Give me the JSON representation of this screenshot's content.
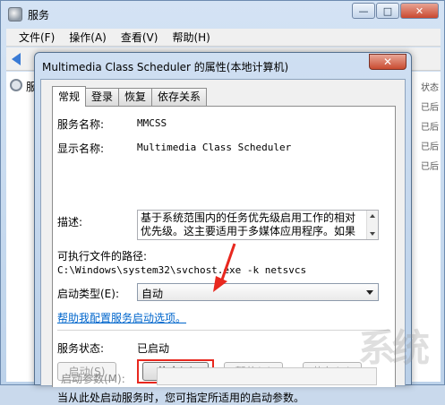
{
  "background_window": {
    "title": "服务",
    "window_buttons": {
      "minimize": "—",
      "maximize": "□",
      "close": "✕"
    },
    "menu": [
      "文件(F)",
      "操作(A)",
      "查看(V)",
      "帮助(H)"
    ],
    "tree_label": "服",
    "right_fragments": [
      "状态",
      "",
      "已后",
      "已后",
      "",
      "",
      "已后",
      "已后",
      "",
      "",
      "",
      "",
      "已后"
    ]
  },
  "dialog": {
    "title": "Multimedia Class Scheduler 的属性(本地计算机)",
    "close_label": "✕",
    "tabs": [
      {
        "label": "常规",
        "active": true
      },
      {
        "label": "登录",
        "active": false
      },
      {
        "label": "恢复",
        "active": false
      },
      {
        "label": "依存关系",
        "active": false
      }
    ],
    "fields": {
      "service_name_label": "服务名称:",
      "service_name_value": "MMCSS",
      "display_name_label": "显示名称:",
      "display_name_value": "Multimedia Class Scheduler",
      "description_label": "描述:",
      "description_value": "基于系统范围内的任务优先级启用工作的相对优先级。这主要适用于多媒体应用程序。如果",
      "exe_path_label": "可执行文件的路径:",
      "exe_path_value": "C:\\Windows\\system32\\svchost.exe -k netsvcs",
      "startup_type_label": "启动类型(E):",
      "startup_type_value": "自动",
      "help_link": "帮助我配置服务启动选项。",
      "status_label": "服务状态:",
      "status_value": "已启动",
      "start_note": "当从此处启动服务时，您可指定所适用的启动参数。",
      "start_params_label": "启动参数(M):"
    },
    "buttons": {
      "start": "启动(S)",
      "stop": "停止(T)",
      "pause": "暂停(P)",
      "resume": "恢复(R)"
    },
    "annotation_color": "#e8281f"
  },
  "watermark": "系统"
}
